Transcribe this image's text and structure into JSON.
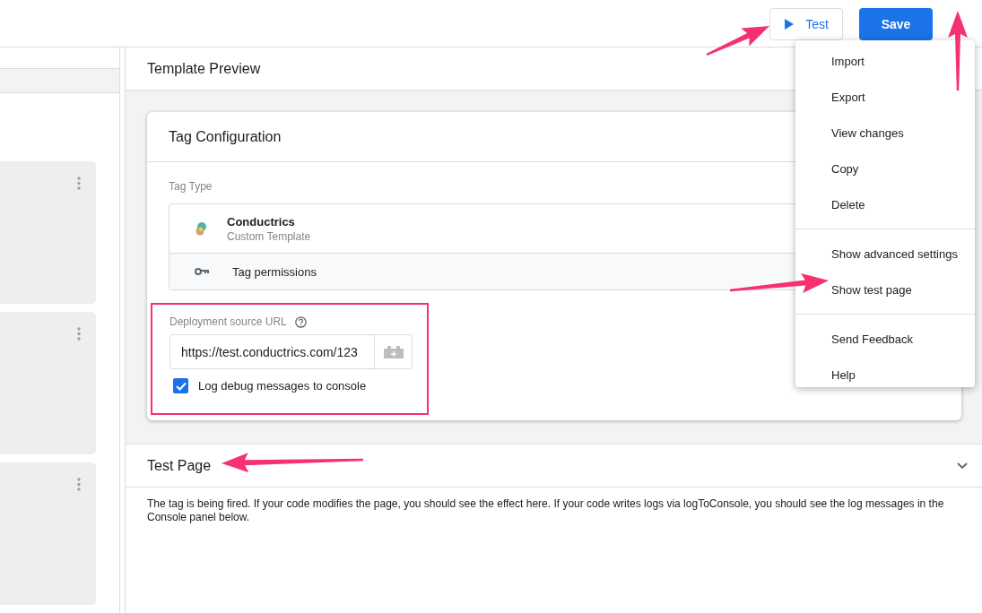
{
  "toolbar": {
    "test_button": "Test",
    "save_button": "Save"
  },
  "preview": {
    "title": "Template Preview"
  },
  "tag_configuration": {
    "title": "Tag Configuration",
    "tag_type_label": "Tag Type",
    "tag_name": "Conductrics",
    "tag_subtitle": "Custom Template",
    "permissions": "Tag permissions",
    "url_label": "Deployment source URL",
    "url_value": "https://test.conductrics.com/123",
    "debug_checkbox": {
      "label": "Log debug messages to console",
      "checked": true
    }
  },
  "menu": {
    "groups": [
      [
        "Import",
        "Export",
        "View changes",
        "Copy",
        "Delete"
      ],
      [
        "Show advanced settings",
        "Show test page"
      ],
      [
        "Send Feedback",
        "Help"
      ]
    ]
  },
  "test_page": {
    "title": "Test Page",
    "expanded": true,
    "text": "The tag is being fired. If your code modifies the page, you should see the effect here. If your code writes logs via logToConsole, you should see the log messages in the Console panel below."
  }
}
